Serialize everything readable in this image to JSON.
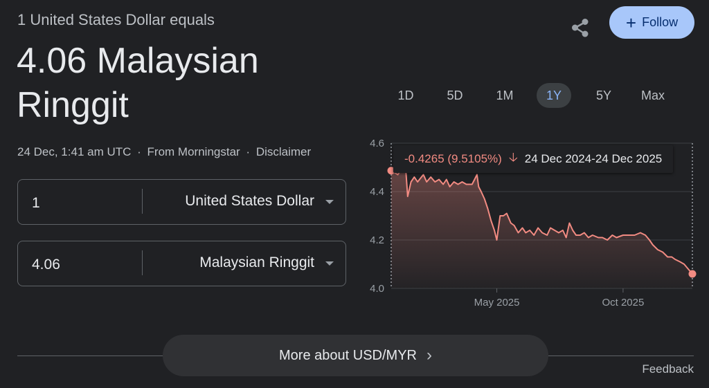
{
  "header": {
    "equals_label": "1 United States Dollar equals",
    "value_text": "4.06 Malaysian Ringgit",
    "timestamp": "24 Dec, 1:41 am UTC",
    "separator": "·",
    "source": "From Morningstar",
    "disclaimer": "Disclaimer"
  },
  "actions": {
    "share_icon": "share-icon",
    "follow_label": "Follow",
    "follow_icon": "plus-icon"
  },
  "converter": {
    "from": {
      "amount": "1",
      "currency": "United States Dollar"
    },
    "to": {
      "amount": "4.06",
      "currency": "Malaysian Ringgit"
    }
  },
  "range_tabs": [
    {
      "label": "1D",
      "active": false
    },
    {
      "label": "5D",
      "active": false
    },
    {
      "label": "1M",
      "active": false
    },
    {
      "label": "1Y",
      "active": true
    },
    {
      "label": "5Y",
      "active": false
    },
    {
      "label": "Max",
      "active": false
    }
  ],
  "tooltip": {
    "change": "-0.4265 (9.5105%)",
    "direction_icon": "arrow-down-icon",
    "range": "24 Dec 2024-24 Dec 2025"
  },
  "chart_data": {
    "type": "line",
    "series": [
      {
        "values": [
          [
            "2024-12-24",
            4.4865
          ],
          [
            "2025-01-01",
            4.47
          ],
          [
            "2025-01-05",
            4.49
          ],
          [
            "2025-01-10",
            4.52
          ],
          [
            "2025-01-13",
            4.38
          ],
          [
            "2025-01-17",
            4.44
          ],
          [
            "2025-01-21",
            4.46
          ],
          [
            "2025-01-25",
            4.44
          ],
          [
            "2025-02-01",
            4.47
          ],
          [
            "2025-02-05",
            4.44
          ],
          [
            "2025-02-10",
            4.46
          ],
          [
            "2025-02-15",
            4.44
          ],
          [
            "2025-02-20",
            4.45
          ],
          [
            "2025-02-25",
            4.43
          ],
          [
            "2025-03-01",
            4.45
          ],
          [
            "2025-03-05",
            4.42
          ],
          [
            "2025-03-10",
            4.44
          ],
          [
            "2025-03-15",
            4.43
          ],
          [
            "2025-03-20",
            4.44
          ],
          [
            "2025-03-25",
            4.43
          ],
          [
            "2025-04-01",
            4.43
          ],
          [
            "2025-04-04",
            4.45
          ],
          [
            "2025-04-07",
            4.47
          ],
          [
            "2025-04-09",
            4.42
          ],
          [
            "2025-04-12",
            4.4
          ],
          [
            "2025-04-16",
            4.37
          ],
          [
            "2025-04-20",
            4.33
          ],
          [
            "2025-04-24",
            4.28
          ],
          [
            "2025-04-28",
            4.24
          ],
          [
            "2025-05-01",
            4.2
          ],
          [
            "2025-05-05",
            4.3
          ],
          [
            "2025-05-09",
            4.3
          ],
          [
            "2025-05-13",
            4.31
          ],
          [
            "2025-05-18",
            4.27
          ],
          [
            "2025-05-22",
            4.26
          ],
          [
            "2025-05-27",
            4.23
          ],
          [
            "2025-06-01",
            4.25
          ],
          [
            "2025-06-05",
            4.23
          ],
          [
            "2025-06-10",
            4.24
          ],
          [
            "2025-06-15",
            4.22
          ],
          [
            "2025-06-20",
            4.25
          ],
          [
            "2025-06-25",
            4.23
          ],
          [
            "2025-07-01",
            4.22
          ],
          [
            "2025-07-05",
            4.25
          ],
          [
            "2025-07-10",
            4.24
          ],
          [
            "2025-07-15",
            4.23
          ],
          [
            "2025-07-20",
            4.24
          ],
          [
            "2025-07-24",
            4.21
          ],
          [
            "2025-07-28",
            4.27
          ],
          [
            "2025-08-01",
            4.24
          ],
          [
            "2025-08-05",
            4.22
          ],
          [
            "2025-08-10",
            4.22
          ],
          [
            "2025-08-15",
            4.23
          ],
          [
            "2025-08-20",
            4.21
          ],
          [
            "2025-08-25",
            4.22
          ],
          [
            "2025-09-01",
            4.21
          ],
          [
            "2025-09-06",
            4.21
          ],
          [
            "2025-09-12",
            4.2
          ],
          [
            "2025-09-18",
            4.22
          ],
          [
            "2025-09-23",
            4.21
          ],
          [
            "2025-10-01",
            4.22
          ],
          [
            "2025-10-08",
            4.22
          ],
          [
            "2025-10-15",
            4.22
          ],
          [
            "2025-10-22",
            4.23
          ],
          [
            "2025-10-28",
            4.22
          ],
          [
            "2025-11-02",
            4.2
          ],
          [
            "2025-11-06",
            4.18
          ],
          [
            "2025-11-12",
            4.16
          ],
          [
            "2025-11-18",
            4.15
          ],
          [
            "2025-11-24",
            4.13
          ],
          [
            "2025-11-29",
            4.13
          ],
          [
            "2025-12-03",
            4.12
          ],
          [
            "2025-12-09",
            4.11
          ],
          [
            "2025-12-14",
            4.1
          ],
          [
            "2025-12-19",
            4.08
          ],
          [
            "2025-12-24",
            4.06
          ]
        ]
      }
    ],
    "ylim": [
      4.0,
      4.6
    ],
    "yticks": [
      "4.6",
      "4.4",
      "4.2",
      "4.0"
    ],
    "xticks": [
      {
        "label": "May 2025",
        "date": "2025-05-01"
      },
      {
        "label": "Oct 2025",
        "date": "2025-10-01"
      }
    ],
    "xlim": [
      "2024-12-24",
      "2025-12-24"
    ],
    "grid": true,
    "line_color": "#f28b82"
  },
  "footer": {
    "more_label": "More about USD/MYR",
    "more_icon": "chevron-right-icon",
    "feedback": "Feedback"
  }
}
